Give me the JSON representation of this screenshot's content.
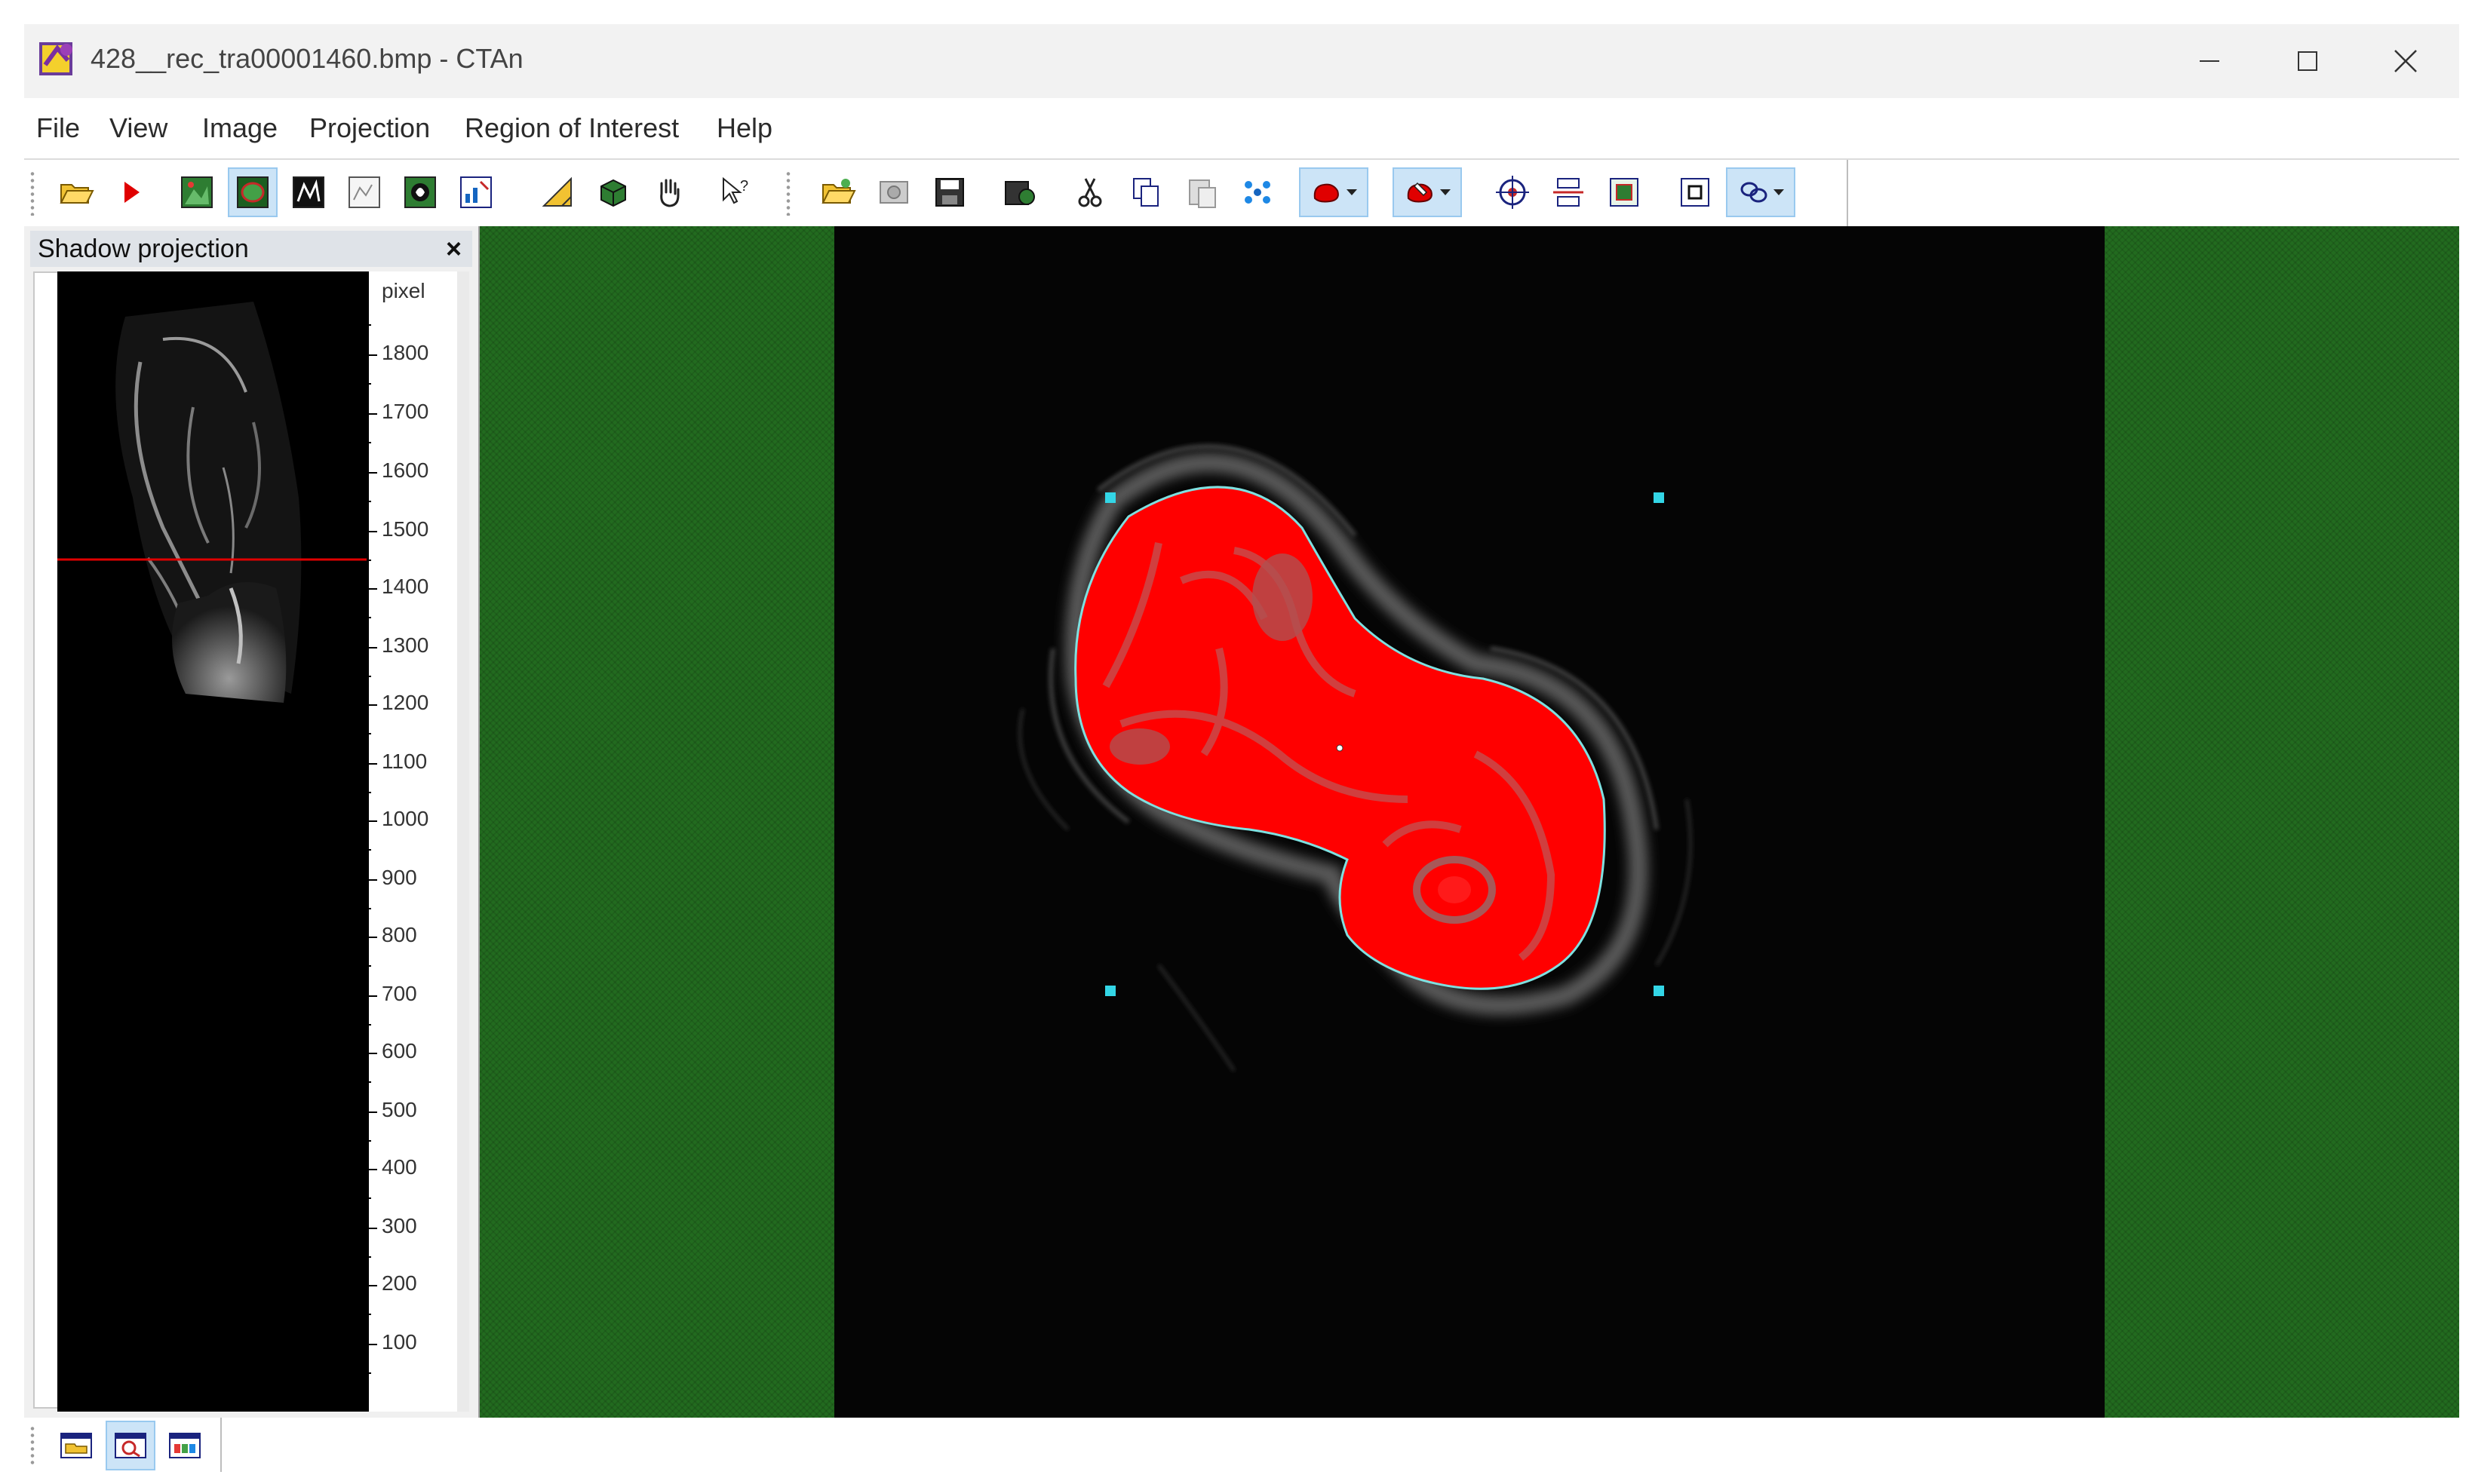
{
  "window": {
    "title": "428__rec_tra00001460.bmp - CTAn",
    "controls": [
      "minimize",
      "maximize",
      "close"
    ]
  },
  "menu": [
    "File",
    "View",
    "Image",
    "Projection",
    "Region of Interest",
    "Help"
  ],
  "toolbar": {
    "group1": [
      "open-folder-icon",
      "play-icon",
      "raw-image-icon",
      "roi-image-icon",
      "binary-image-icon",
      "processed-image-icon",
      "custom-processing-icon",
      "analysis-icon",
      "measure-icon",
      "3d-model-icon",
      "pan-hand-icon",
      "context-help-icon"
    ],
    "group2": [
      "open-dataset-icon",
      "settings-icon",
      "save-icon",
      "save-roi-icon",
      "cut-icon",
      "copy-icon",
      "paste-icon",
      "interpolate-icon",
      "roi-shape-dropdown",
      "roi-edit-dropdown",
      "crosshair-icon",
      "align-icon",
      "fit-icon",
      "rectangle-roi-icon",
      "link-dropdown"
    ],
    "active": [
      "roi-image-icon",
      "roi-shape-dropdown",
      "roi-edit-dropdown",
      "link-dropdown"
    ]
  },
  "shadow_panel": {
    "title": "Shadow projection",
    "close_label": "×",
    "unit": "pixel",
    "ruler_labels": [
      "1800",
      "1700",
      "1600",
      "1500",
      "1400",
      "1300",
      "1200",
      "1100",
      "1000",
      "900",
      "800",
      "700",
      "600",
      "500",
      "400",
      "300",
      "200",
      "100"
    ],
    "current_slice_line_color": "#e00000"
  },
  "viewer": {
    "background_color": "#226b1f",
    "roi_fill_color": "#ff0000",
    "roi_outline_color": "#7fe0e0",
    "handle_color": "#33d6e6"
  },
  "bottom_toolbar": [
    "dataset-browser-icon",
    "roi-preview-icon",
    "color-palette-icon"
  ]
}
